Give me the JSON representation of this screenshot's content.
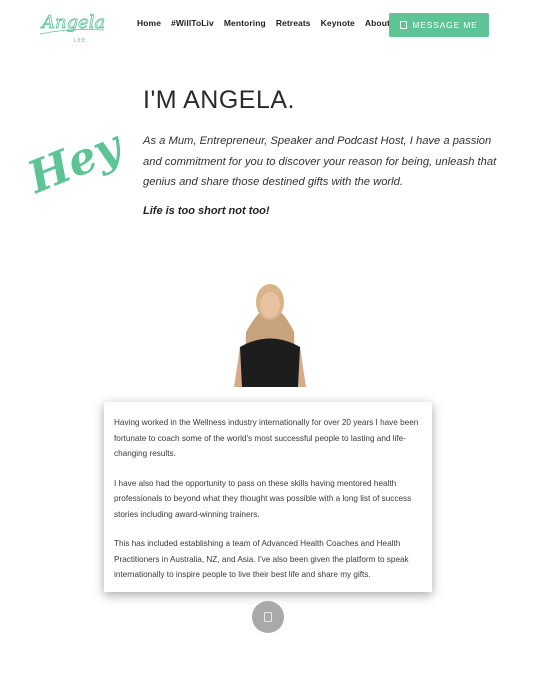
{
  "header": {
    "logo_text": "Angela",
    "logo_sub": "LEE",
    "nav": [
      "Home",
      "#WillToLiv",
      "Mentoring",
      "Retreats",
      "Keynote",
      "About"
    ],
    "cta_label": "MESSAGE ME",
    "cta_icon": "message-icon"
  },
  "hero": {
    "greeting": "Hey!",
    "title": "I'M ANGELA.",
    "intro": "As a Mum, Entrepreneur, Speaker and Podcast Host, I have a passion and commitment for you to discover your reason for being, unleash that genius and share those destined gifts with the world.",
    "tagline": "Life is too short not too!"
  },
  "about": {
    "paragraphs": [
      "Having worked in the Wellness industry internationally for over 20 years I have been fortunate to coach some of the world's most successful people to lasting and life-changing results.",
      "I have also had the opportunity to pass on these skills having mentored health professionals to beyond what they thought was possible with a long list of success stories including award-winning trainers.",
      "This has included establishing a team of Advanced Health Coaches and Health Practitioners in Australia, NZ, and Asia. I've also been given the platform to speak internationally to inspire people to live their best life and share my gifts."
    ]
  },
  "colors": {
    "accent": "#5ec395",
    "scroll_button": "#a9a9a9"
  }
}
